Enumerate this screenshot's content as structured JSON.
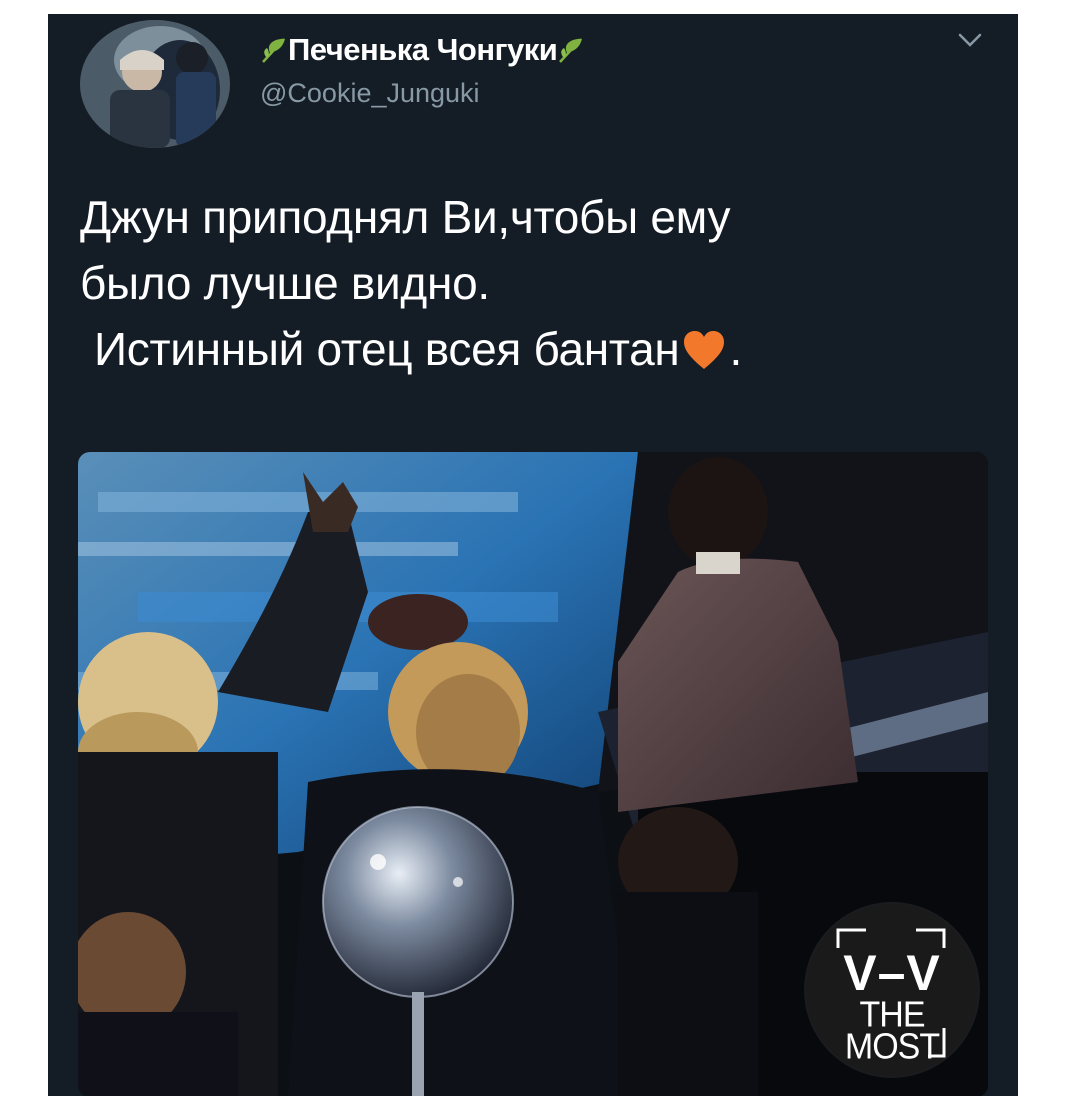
{
  "tweet": {
    "author": {
      "display_name": "Печенька Чонгуки",
      "handle": "@Cookie_Junguki",
      "name_decoration_icon": "leaf-icon"
    },
    "menu_icon": "chevron-down-icon",
    "text": {
      "line1": "Джун приподнял Ви,чтобы ему",
      "line2": "было лучше видно.",
      "line3_before_emoji": "Истинный отец всея бантан",
      "line3_after_emoji": ".",
      "emoji_icon": "orange-heart-icon"
    },
    "media": {
      "watermark": {
        "line1": "V–V",
        "line2": "THE",
        "line3": "MOST"
      }
    }
  },
  "colors": {
    "background": "#141d26",
    "text": "#ffffff",
    "handle": "#8899a6",
    "heart": "#f2782c",
    "leaf": "#7fb241",
    "page": "#ffffff"
  }
}
